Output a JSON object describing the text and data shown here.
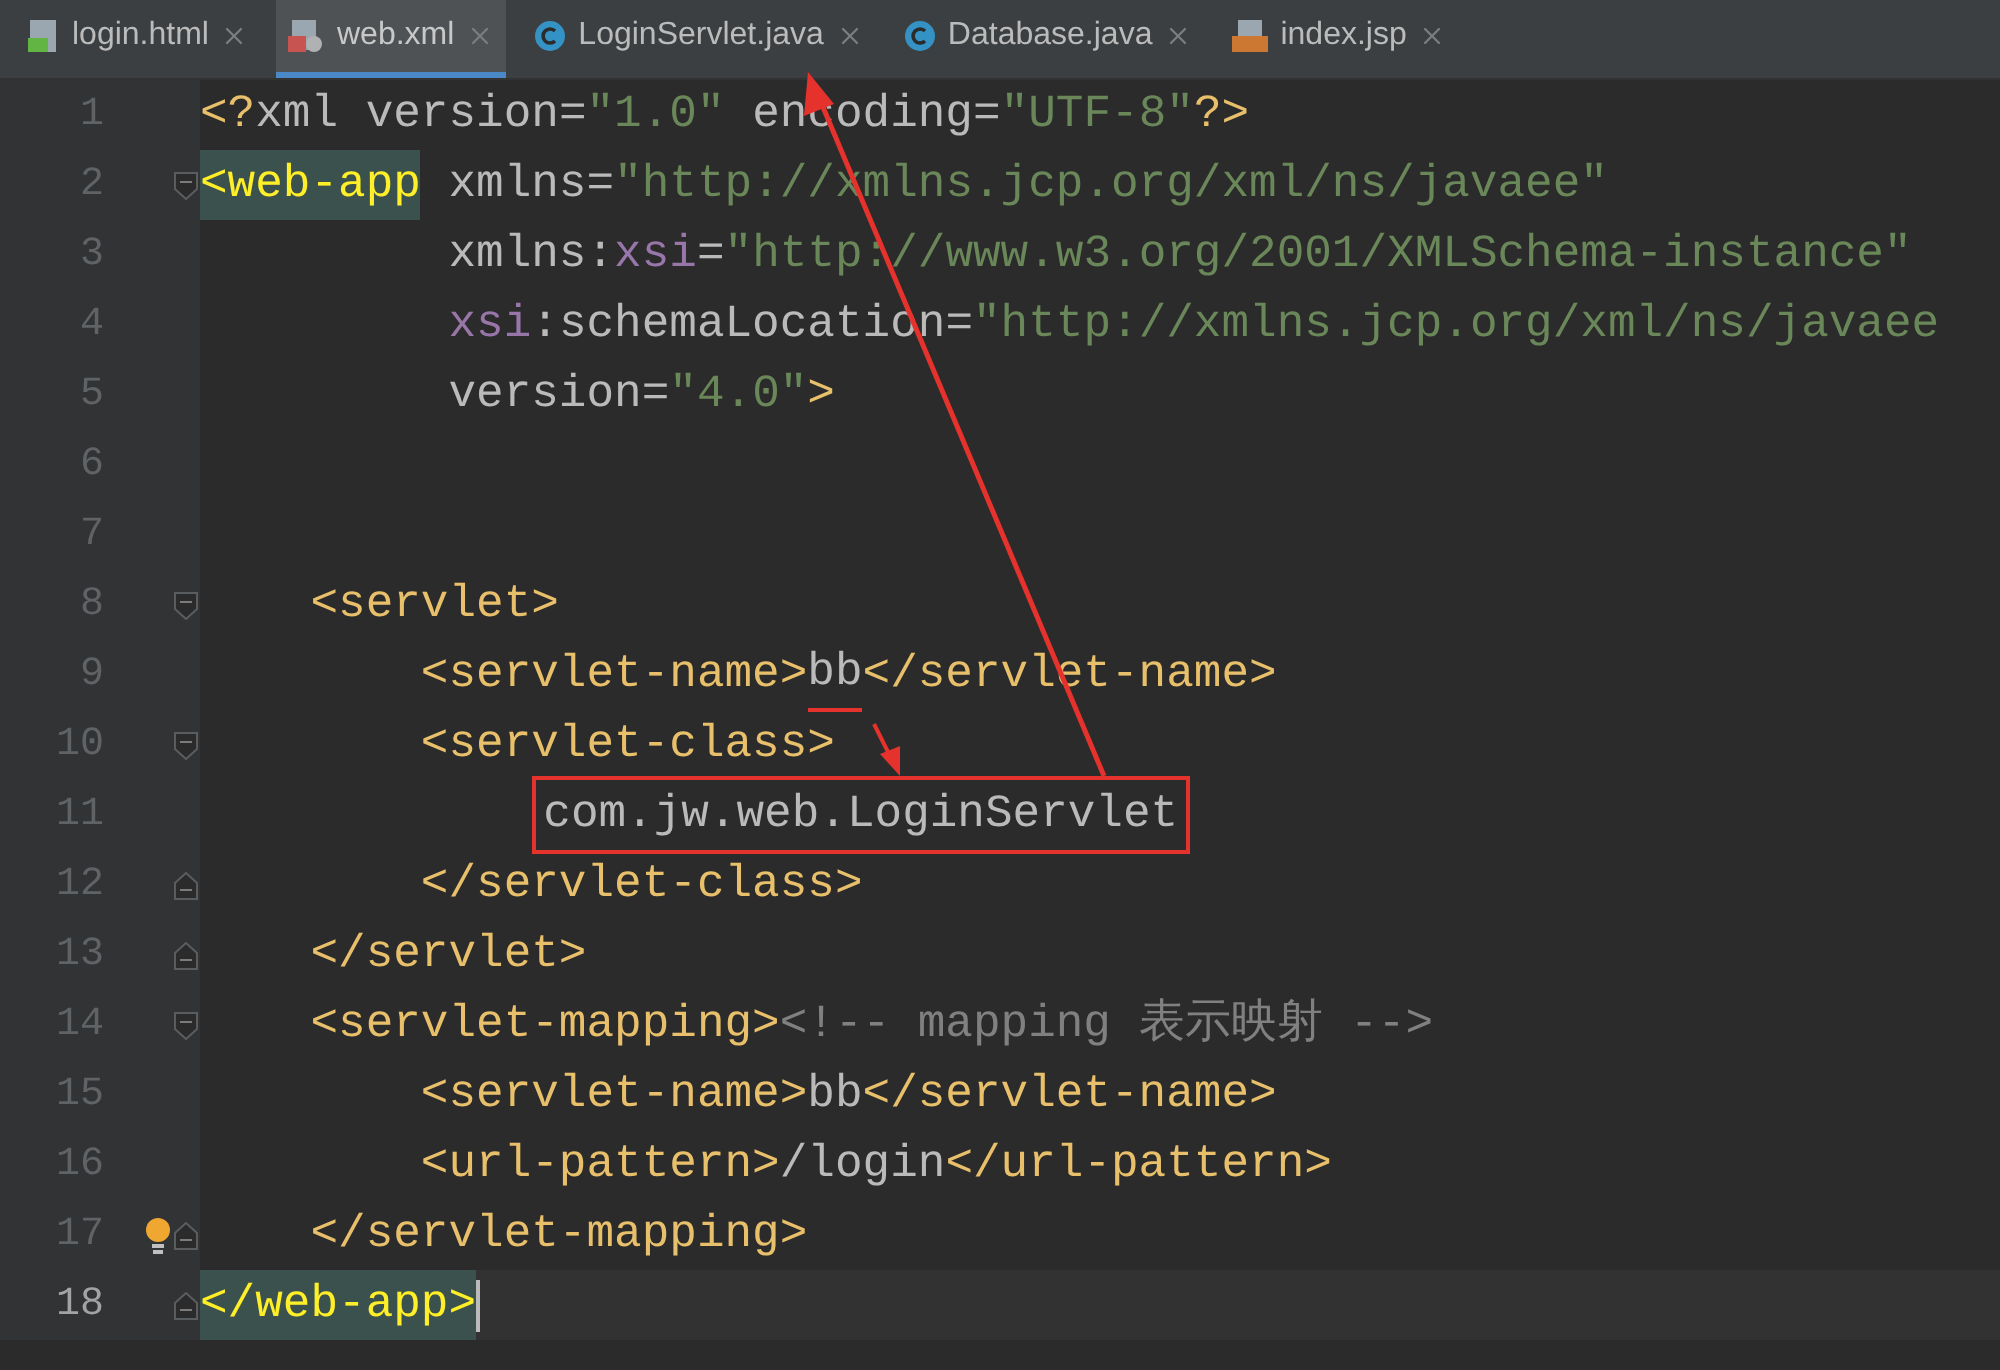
{
  "tabs": [
    {
      "label": "login.html",
      "kind": "html",
      "selected": false
    },
    {
      "label": "web.xml",
      "kind": "xml",
      "selected": true
    },
    {
      "label": "LoginServlet.java",
      "kind": "java",
      "selected": false
    },
    {
      "label": "Database.java",
      "kind": "java",
      "selected": false
    },
    {
      "label": "index.jsp",
      "kind": "jsp",
      "selected": false
    }
  ],
  "lines": [
    {
      "number": "1",
      "current": false,
      "bulb": false,
      "tokens": [
        {
          "text": "<?",
          "kind": "tag"
        },
        {
          "text": "xml version",
          "kind": "text"
        },
        {
          "text": "=",
          "kind": "text"
        },
        {
          "text": "\"1.0\"",
          "kind": "value"
        },
        {
          "text": " encoding",
          "kind": "text"
        },
        {
          "text": "=",
          "kind": "text"
        },
        {
          "text": "\"UTF-8\"",
          "kind": "value"
        },
        {
          "text": "?>",
          "kind": "tag"
        }
      ]
    },
    {
      "number": "2",
      "current": false,
      "bulb": false,
      "fold": {
        "kind": "open"
      },
      "tokens": [
        {
          "text": "<web-app",
          "kind": "tag",
          "matched": true
        },
        {
          "text": " xmlns",
          "kind": "text"
        },
        {
          "text": "=",
          "kind": "text"
        },
        {
          "text": "\"http://xmlns.jcp.org/xml/ns/javaee\"",
          "kind": "value"
        }
      ]
    },
    {
      "number": "3",
      "current": false,
      "bulb": false,
      "tokens": [
        {
          "text": "         xmlns:",
          "kind": "text"
        },
        {
          "text": "xsi",
          "kind": "ns"
        },
        {
          "text": "=",
          "kind": "text"
        },
        {
          "text": "\"http://www.w3.org/2001/XMLSchema-instance\"",
          "kind": "value"
        }
      ]
    },
    {
      "number": "4",
      "current": false,
      "bulb": false,
      "tokens": [
        {
          "text": "         xsi",
          "kind": "ns"
        },
        {
          "text": ":schemaLocation",
          "kind": "text"
        },
        {
          "text": "=",
          "kind": "text"
        },
        {
          "text": "\"http://xmlns.jcp.org/xml/ns/javaee",
          "kind": "value"
        }
      ]
    },
    {
      "number": "5",
      "current": false,
      "bulb": false,
      "tokens": [
        {
          "text": "         version",
          "kind": "text"
        },
        {
          "text": "=",
          "kind": "text"
        },
        {
          "text": "\"4.0\"",
          "kind": "value"
        },
        {
          "text": ">",
          "kind": "tag"
        }
      ]
    },
    {
      "number": "6",
      "current": false,
      "bulb": false
    },
    {
      "number": "7",
      "current": false,
      "bulb": false
    },
    {
      "number": "8",
      "current": false,
      "bulb": false,
      "fold": {
        "kind": "open"
      },
      "tokens": [
        {
          "text": "    <servlet>",
          "kind": "tag"
        }
      ]
    },
    {
      "number": "9",
      "current": false,
      "bulb": false,
      "tokens": [
        {
          "text": "        <servlet-name>",
          "kind": "tag"
        },
        {
          "text": "bb",
          "kind": "text",
          "underlined": true
        },
        {
          "text": "</servlet-name>",
          "kind": "tag"
        }
      ]
    },
    {
      "number": "10",
      "current": false,
      "bulb": false,
      "fold": {
        "kind": "open"
      },
      "tokens": [
        {
          "text": "        <servlet-class>",
          "kind": "tag"
        }
      ]
    },
    {
      "number": "11",
      "current": false,
      "bulb": false,
      "tokens": [
        {
          "text": "            com.jw.web.LoginServlet",
          "kind": "text",
          "boxed": true
        }
      ]
    },
    {
      "number": "12",
      "current": false,
      "bulb": false,
      "fold": {
        "kind": "close"
      },
      "tokens": [
        {
          "text": "        </servlet-class>",
          "kind": "tag"
        }
      ]
    },
    {
      "number": "13",
      "current": false,
      "bulb": false,
      "fold": {
        "kind": "close"
      },
      "tokens": [
        {
          "text": "    </servlet>",
          "kind": "tag"
        }
      ]
    },
    {
      "number": "14",
      "current": false,
      "bulb": false,
      "fold": {
        "kind": "open"
      },
      "tokens": [
        {
          "text": "    <servlet-mapping>",
          "kind": "tag"
        },
        {
          "text": "<!-- mapping 表示映射 -->",
          "kind": "comment"
        }
      ]
    },
    {
      "number": "15",
      "current": false,
      "bulb": false,
      "tokens": [
        {
          "text": "        <servlet-name>",
          "kind": "tag"
        },
        {
          "text": "bb",
          "kind": "text"
        },
        {
          "text": "</servlet-name>",
          "kind": "tag"
        }
      ]
    },
    {
      "number": "16",
      "current": false,
      "bulb": false,
      "tokens": [
        {
          "text": "        <url-pattern>",
          "kind": "tag"
        },
        {
          "text": "/login",
          "kind": "text"
        },
        {
          "text": "</url-pattern>",
          "kind": "tag"
        }
      ]
    },
    {
      "number": "17",
      "current": false,
      "bulb": true,
      "fold": {
        "kind": "close"
      },
      "tokens": [
        {
          "text": "    </servlet-mapping>",
          "kind": "tag"
        }
      ]
    },
    {
      "number": "18",
      "current": true,
      "bulb": false,
      "fold": {
        "kind": "close"
      },
      "tokens": [
        {
          "text": "</web-app>",
          "kind": "tag",
          "matched": true
        }
      ]
    }
  ]
}
